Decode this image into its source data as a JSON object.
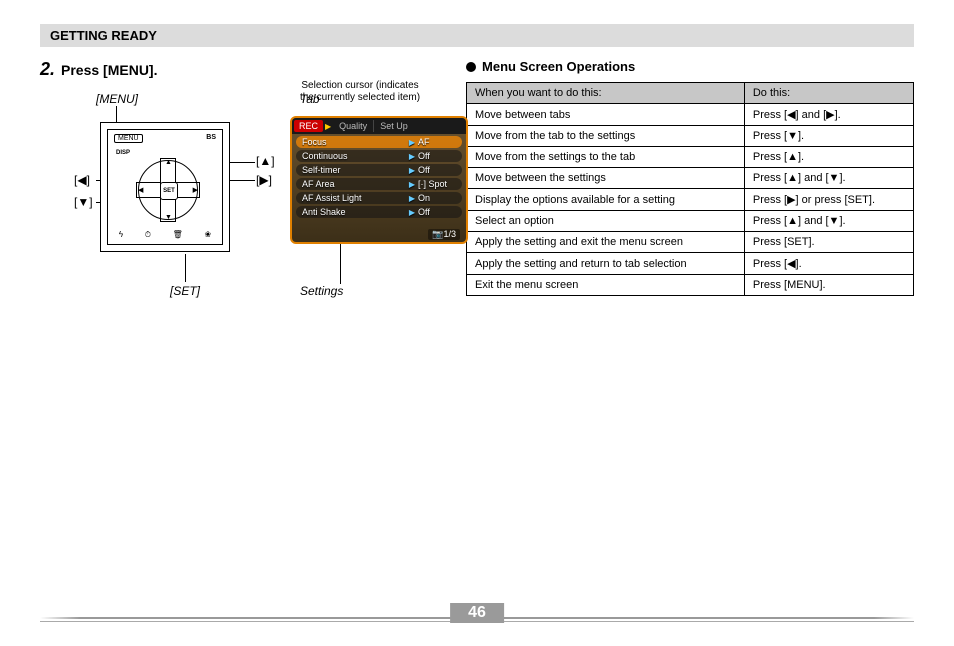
{
  "header": "GETTING READY",
  "step": {
    "num": "2.",
    "text": "Press [MENU]."
  },
  "cursor_note_l1": "Selection cursor (indicates",
  "cursor_note_l2": "the currently selected item)",
  "labels": {
    "menu": "[MENU]",
    "set": "[SET]",
    "tab": "Tab",
    "settings": "Settings",
    "up": "[▲]",
    "down": "[▼]",
    "left": "[◀]",
    "right": "[▶]"
  },
  "cam": {
    "menu": "MENU",
    "bs": "BS",
    "disp": "DISP",
    "set": "SET"
  },
  "lcd": {
    "tabs": [
      "REC",
      "Quality",
      "Set Up"
    ],
    "rows": [
      {
        "k": "Focus",
        "v": "AF",
        "sel": true
      },
      {
        "k": "Continuous",
        "v": "Off"
      },
      {
        "k": "Self-timer",
        "v": "Off"
      },
      {
        "k": "AF Area",
        "v": "[·] Spot"
      },
      {
        "k": "AF Assist Light",
        "v": "On"
      },
      {
        "k": "Anti Shake",
        "v": "Off"
      }
    ],
    "page": "1/3"
  },
  "right_heading": "Menu Screen Operations",
  "table": {
    "head": [
      "When you want to do this:",
      "Do this:"
    ],
    "rows": [
      {
        "a": "Move between tabs",
        "b": "Press [◀] and [▶]."
      },
      {
        "a": "Move from the tab to the settings",
        "b": "Press [▼]."
      },
      {
        "a": "Move from the settings to the tab",
        "b": "Press [▲]."
      },
      {
        "a": "Move between the settings",
        "b": "Press [▲] and [▼]."
      },
      {
        "a": "Display the options available for a setting",
        "b": "Press [▶] or press [SET]."
      },
      {
        "a": "Select an option",
        "b": "Press [▲] and [▼]."
      },
      {
        "a": "Apply the setting and exit the menu screen",
        "b": "Press [SET]."
      },
      {
        "a": "Apply the setting and return to tab selection",
        "b": "Press [◀]."
      },
      {
        "a": "Exit the menu screen",
        "b": "Press [MENU]."
      }
    ]
  },
  "page_number": "46"
}
